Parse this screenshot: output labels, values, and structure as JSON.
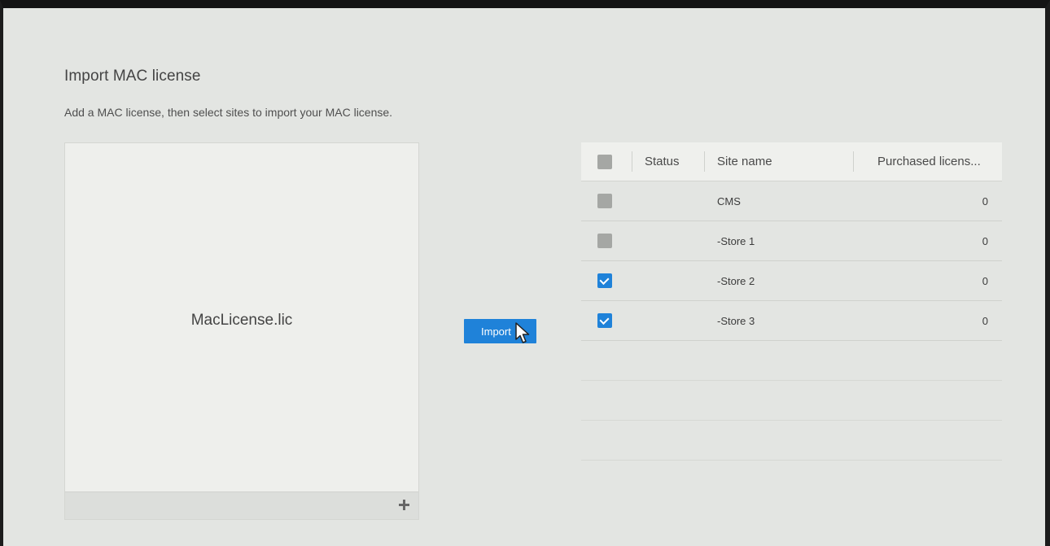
{
  "page": {
    "title": "Import MAC license",
    "subtitle": "Add a MAC license, then select sites to import your MAC license."
  },
  "file_panel": {
    "file_name": "MacLicense.lic",
    "add_icon": "plus-icon"
  },
  "import_button": {
    "label": "Import"
  },
  "table": {
    "headers": {
      "status": "Status",
      "site_name": "Site name",
      "purchased": "Purchased licens..."
    },
    "select_all_checked": false,
    "rows": [
      {
        "site_name": "CMS",
        "purchased": "0",
        "checked": false
      },
      {
        "site_name": "-Store 1",
        "purchased": "0",
        "checked": false
      },
      {
        "site_name": "-Store 2",
        "purchased": "0",
        "checked": true
      },
      {
        "site_name": "-Store 3",
        "purchased": "0",
        "checked": true
      }
    ]
  },
  "colors": {
    "accent": "#1f82d9",
    "background": "#e3e5e2",
    "checkbox_unchecked": "#a5a7a4"
  }
}
